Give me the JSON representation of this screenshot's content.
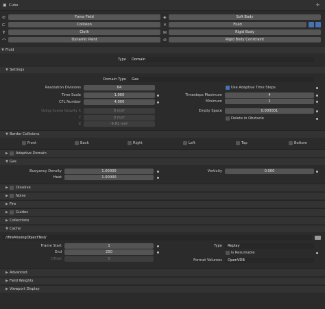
{
  "header": {
    "object_name": "Cube"
  },
  "physics_buttons": {
    "left": [
      "Force Field",
      "Collision",
      "Cloth",
      "Dynamic Paint"
    ],
    "right": [
      "Soft Body",
      "Fluid",
      "Rigid Body",
      "Rigid Body Constraint"
    ]
  },
  "fluid": {
    "panel_title": "Fluid",
    "type_label": "Type",
    "type_value": "Domain",
    "settings": {
      "title": "Settings",
      "domain_type_label": "Domain Type",
      "domain_type_value": "Gas",
      "resolution_label": "Resolution Divisions",
      "resolution_value": "64",
      "time_scale_label": "Time Scale",
      "time_scale_value": "1.000",
      "cfl_label": "CFL Number",
      "cfl_value": "4.000",
      "use_adaptive_label": "Use Adaptive Time Steps",
      "ts_max_label": "Timesteps Maximum",
      "ts_max_value": "4",
      "minimum_label": "Minimum",
      "minimum_value": "1",
      "scene_gravity_label": "Using Scene Gravity X",
      "gravity_x": "0 m/s²",
      "gravity_y_label": "Y",
      "gravity_y": "0 m/s²",
      "gravity_z_label": "Z",
      "gravity_z": "-9.81 m/s²",
      "empty_space_label": "Empty Space",
      "empty_space_value": "0.000001",
      "delete_obstacle_label": "Delete in Obstacle"
    },
    "border_collisions": {
      "title": "Border Collisions",
      "items": [
        "Front",
        "Back",
        "Right",
        "Left",
        "Top",
        "Bottom"
      ]
    },
    "adaptive_domain": {
      "title": "Adaptive Domain"
    },
    "gas": {
      "title": "Gas",
      "buoyancy_label": "Buoyancy Density",
      "buoyancy_value": "1.00000",
      "heat_label": "Heat",
      "heat_value": "1.00000",
      "vorticity_label": "Vorticity",
      "vorticity_value": "0.000"
    },
    "subpanels": [
      "Dissolve",
      "Noise",
      "Fire",
      "Guides",
      "Collections"
    ],
    "cache": {
      "title": "Cache",
      "path": "//fireMovingObjectTest/",
      "frame_start_label": "Frame Start",
      "frame_start_value": "1",
      "end_label": "End",
      "end_value": "250",
      "offset_label": "Offset",
      "offset_value": "0",
      "type_label": "Type",
      "type_value": "Replay",
      "resumable_label": "Is Resumable",
      "format_label": "Format Volumes",
      "format_value": "OpenVDB"
    },
    "bottom_panels": [
      "Advanced",
      "Field Weights",
      "Viewport Display"
    ]
  }
}
